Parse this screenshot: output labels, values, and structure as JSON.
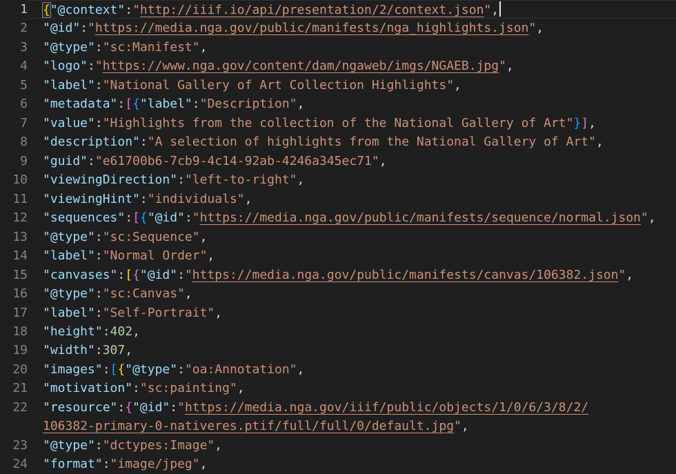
{
  "editor": {
    "colors": {
      "bg": "#1f1f1f",
      "gutter": "#858585",
      "gutterActive": "#c6c6c6",
      "lineHighlightBorder": "#2d2d2d",
      "key": "#9cdcfe",
      "string": "#ce9178",
      "number": "#b5cea8",
      "punct": "#d4d4d4",
      "bracket1": "#ffd700",
      "bracket2": "#da70d6",
      "bracket3": "#179fff",
      "bracketMatchBorder": "#828282",
      "cursor": "#e6e6e6"
    },
    "cursor_line": 1,
    "lines": [
      {
        "num": "1",
        "active": true,
        "cursor": true,
        "tokens": [
          [
            "bm",
            "{"
          ],
          [
            "k",
            "\"@context\""
          ],
          [
            "p",
            ":"
          ],
          [
            "s",
            "\""
          ],
          [
            "u",
            "http://iiif.io/api/presentation/2/context.json"
          ],
          [
            "s",
            "\""
          ],
          [
            "p",
            ","
          ]
        ]
      },
      {
        "num": "2",
        "tokens": [
          [
            "k",
            "\"@id\""
          ],
          [
            "p",
            ":"
          ],
          [
            "s",
            "\""
          ],
          [
            "u",
            "https://media.nga.gov/public/manifests/nga_highlights.json"
          ],
          [
            "s",
            "\""
          ],
          [
            "p",
            ","
          ]
        ]
      },
      {
        "num": "3",
        "tokens": [
          [
            "k",
            "\"@type\""
          ],
          [
            "p",
            ":"
          ],
          [
            "s",
            "\"sc:Manifest\""
          ],
          [
            "p",
            ","
          ]
        ]
      },
      {
        "num": "4",
        "tokens": [
          [
            "k",
            "\"logo\""
          ],
          [
            "p",
            ":"
          ],
          [
            "s",
            "\""
          ],
          [
            "u",
            "https://www.nga.gov/content/dam/ngaweb/imgs/NGAEB.jpg"
          ],
          [
            "s",
            "\""
          ],
          [
            "p",
            ","
          ]
        ]
      },
      {
        "num": "5",
        "tokens": [
          [
            "k",
            "\"label\""
          ],
          [
            "p",
            ":"
          ],
          [
            "s",
            "\"National Gallery of Art Collection Highlights\""
          ],
          [
            "p",
            ","
          ]
        ]
      },
      {
        "num": "6",
        "tokens": [
          [
            "k",
            "\"metadata\""
          ],
          [
            "p",
            ":"
          ],
          [
            "b2",
            "["
          ],
          [
            "b3",
            "{"
          ],
          [
            "k",
            "\"label\""
          ],
          [
            "p",
            ":"
          ],
          [
            "s",
            "\"Description\""
          ],
          [
            "p",
            ","
          ]
        ]
      },
      {
        "num": "7",
        "tokens": [
          [
            "k",
            "\"value\""
          ],
          [
            "p",
            ":"
          ],
          [
            "s",
            "\"Highlights from the collection of the National Gallery of Art\""
          ],
          [
            "b3",
            "}"
          ],
          [
            "b2",
            "]"
          ],
          [
            "p",
            ","
          ]
        ]
      },
      {
        "num": "8",
        "tokens": [
          [
            "k",
            "\"description\""
          ],
          [
            "p",
            ":"
          ],
          [
            "s",
            "\"A selection of highlights from the National Gallery of Art\""
          ],
          [
            "p",
            ","
          ]
        ]
      },
      {
        "num": "9",
        "tokens": [
          [
            "k",
            "\"guid\""
          ],
          [
            "p",
            ":"
          ],
          [
            "s",
            "\"e61700b6-7cb9-4c14-92ab-4246a345ec71\""
          ],
          [
            "p",
            ","
          ]
        ]
      },
      {
        "num": "10",
        "tokens": [
          [
            "k",
            "\"viewingDirection\""
          ],
          [
            "p",
            ":"
          ],
          [
            "s",
            "\"left-to-right\""
          ],
          [
            "p",
            ","
          ]
        ]
      },
      {
        "num": "11",
        "tokens": [
          [
            "k",
            "\"viewingHint\""
          ],
          [
            "p",
            ":"
          ],
          [
            "s",
            "\"individuals\""
          ],
          [
            "p",
            ","
          ]
        ]
      },
      {
        "num": "12",
        "tokens": [
          [
            "k",
            "\"sequences\""
          ],
          [
            "p",
            ":"
          ],
          [
            "b2",
            "["
          ],
          [
            "b3",
            "{"
          ],
          [
            "k",
            "\"@id\""
          ],
          [
            "p",
            ":"
          ],
          [
            "s",
            "\""
          ],
          [
            "u",
            "https://media.nga.gov/public/manifests/sequence/normal.json"
          ],
          [
            "s",
            "\""
          ],
          [
            "p",
            ","
          ]
        ]
      },
      {
        "num": "13",
        "tokens": [
          [
            "k",
            "\"@type\""
          ],
          [
            "p",
            ":"
          ],
          [
            "s",
            "\"sc:Sequence\""
          ],
          [
            "p",
            ","
          ]
        ]
      },
      {
        "num": "14",
        "tokens": [
          [
            "k",
            "\"label\""
          ],
          [
            "p",
            ":"
          ],
          [
            "s",
            "\"Normal Order\""
          ],
          [
            "p",
            ","
          ]
        ]
      },
      {
        "num": "15",
        "tokens": [
          [
            "k",
            "\"canvases\""
          ],
          [
            "p",
            ":"
          ],
          [
            "b1",
            "["
          ],
          [
            "b2",
            "{"
          ],
          [
            "k",
            "\"@id\""
          ],
          [
            "p",
            ":"
          ],
          [
            "s",
            "\""
          ],
          [
            "u",
            "https://media.nga.gov/public/manifests/canvas/106382.json"
          ],
          [
            "s",
            "\""
          ],
          [
            "p",
            ","
          ]
        ]
      },
      {
        "num": "16",
        "tokens": [
          [
            "k",
            "\"@type\""
          ],
          [
            "p",
            ":"
          ],
          [
            "s",
            "\"sc:Canvas\""
          ],
          [
            "p",
            ","
          ]
        ]
      },
      {
        "num": "17",
        "tokens": [
          [
            "k",
            "\"label\""
          ],
          [
            "p",
            ":"
          ],
          [
            "s",
            "\"Self-Portrait\""
          ],
          [
            "p",
            ","
          ]
        ]
      },
      {
        "num": "18",
        "tokens": [
          [
            "k",
            "\"height\""
          ],
          [
            "p",
            ":"
          ],
          [
            "n",
            "402"
          ],
          [
            "p",
            ","
          ]
        ]
      },
      {
        "num": "19",
        "tokens": [
          [
            "k",
            "\"width\""
          ],
          [
            "p",
            ":"
          ],
          [
            "n",
            "307"
          ],
          [
            "p",
            ","
          ]
        ]
      },
      {
        "num": "20",
        "tokens": [
          [
            "k",
            "\"images\""
          ],
          [
            "p",
            ":"
          ],
          [
            "b3",
            "["
          ],
          [
            "b1",
            "{"
          ],
          [
            "k",
            "\"@type\""
          ],
          [
            "p",
            ":"
          ],
          [
            "s",
            "\"oa:Annotation\""
          ],
          [
            "p",
            ","
          ]
        ]
      },
      {
        "num": "21",
        "tokens": [
          [
            "k",
            "\"motivation\""
          ],
          [
            "p",
            ":"
          ],
          [
            "s",
            "\"sc:painting\""
          ],
          [
            "p",
            ","
          ]
        ]
      },
      {
        "num": "22",
        "tokens": [
          [
            "k",
            "\"resource\""
          ],
          [
            "p",
            ":"
          ],
          [
            "b2",
            "{"
          ],
          [
            "k",
            "\"@id\""
          ],
          [
            "p",
            ":"
          ],
          [
            "s",
            "\""
          ],
          [
            "u",
            "https://media.nga.gov/iiif/public/objects/1/0/6/3/8/2/"
          ]
        ]
      },
      {
        "num": "",
        "wrap": true,
        "tokens": [
          [
            "u",
            "106382-primary-0-nativeres.ptif/full/full/0/default.jpg"
          ],
          [
            "s",
            "\""
          ],
          [
            "p",
            ","
          ]
        ]
      },
      {
        "num": "23",
        "tokens": [
          [
            "k",
            "\"@type\""
          ],
          [
            "p",
            ":"
          ],
          [
            "s",
            "\"dctypes:Image\""
          ],
          [
            "p",
            ","
          ]
        ]
      },
      {
        "num": "24",
        "tokens": [
          [
            "k",
            "\"format\""
          ],
          [
            "p",
            ":"
          ],
          [
            "s",
            "\"image/jpeg\""
          ],
          [
            "p",
            ","
          ]
        ]
      }
    ]
  }
}
